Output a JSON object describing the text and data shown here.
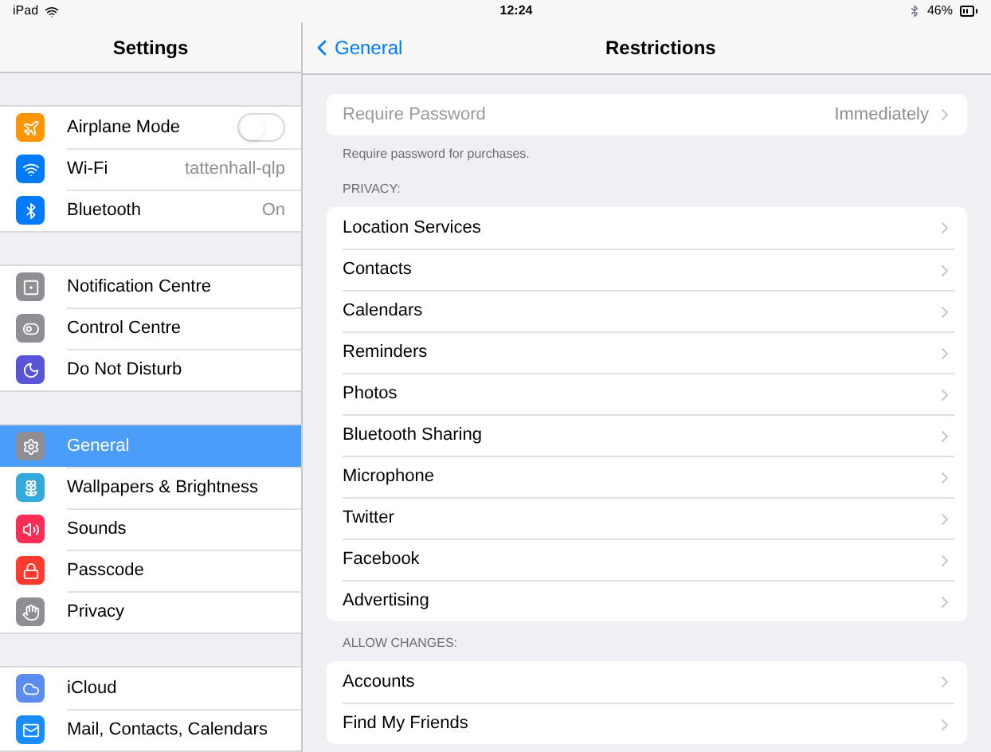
{
  "status_bar": {
    "device": "iPad",
    "time": "12:24",
    "battery": "46%"
  },
  "sidebar": {
    "title": "Settings",
    "groups": [
      [
        {
          "label": "Airplane Mode",
          "color": "#ff9500",
          "kind": "toggle",
          "on": false,
          "selected": false
        },
        {
          "label": "Wi-Fi",
          "color": "#007aff",
          "kind": "value",
          "value": "tattenhall-qlp",
          "selected": false
        },
        {
          "label": "Bluetooth",
          "color": "#007aff",
          "kind": "value",
          "value": "On",
          "selected": false
        }
      ],
      [
        {
          "label": "Notification Centre",
          "color": "#8e8e93",
          "kind": "plain",
          "selected": false
        },
        {
          "label": "Control Centre",
          "color": "#8e8e93",
          "kind": "plain",
          "selected": false
        },
        {
          "label": "Do Not Disturb",
          "color": "#5856d6",
          "kind": "plain",
          "selected": false
        }
      ],
      [
        {
          "label": "General",
          "color": "#8e8e93",
          "kind": "plain",
          "selected": true
        },
        {
          "label": "Wallpapers & Brightness",
          "color": "#34aadc",
          "kind": "plain",
          "selected": false
        },
        {
          "label": "Sounds",
          "color": "#ff2d55",
          "kind": "plain",
          "selected": false
        },
        {
          "label": "Passcode",
          "color": "#ff3b30",
          "kind": "plain",
          "selected": false
        },
        {
          "label": "Privacy",
          "color": "#8e8e93",
          "kind": "plain",
          "selected": false
        }
      ],
      [
        {
          "label": "iCloud",
          "color": "#5b8def",
          "kind": "plain",
          "selected": false
        },
        {
          "label": "Mail, Contacts, Calendars",
          "color": "#1a8cff",
          "kind": "plain",
          "selected": false
        }
      ]
    ]
  },
  "detail": {
    "back": "General",
    "title": "Restrictions",
    "sections": [
      {
        "rows": [
          {
            "label": "Require Password",
            "value": "Immediately",
            "disabled": true
          }
        ],
        "footer": "Require password for purchases."
      },
      {
        "header": "PRIVACY:",
        "rows": [
          {
            "label": "Location Services",
            "disabled": false
          },
          {
            "label": "Contacts",
            "disabled": false
          },
          {
            "label": "Calendars",
            "disabled": false
          },
          {
            "label": "Reminders",
            "disabled": false
          },
          {
            "label": "Photos",
            "disabled": false
          },
          {
            "label": "Bluetooth Sharing",
            "disabled": false
          },
          {
            "label": "Microphone",
            "disabled": false
          },
          {
            "label": "Twitter",
            "disabled": false
          },
          {
            "label": "Facebook",
            "disabled": false
          },
          {
            "label": "Advertising",
            "disabled": false
          }
        ]
      },
      {
        "header": "ALLOW CHANGES:",
        "rows": [
          {
            "label": "Accounts",
            "disabled": false
          },
          {
            "label": "Find My Friends",
            "disabled": false
          }
        ]
      }
    ]
  }
}
